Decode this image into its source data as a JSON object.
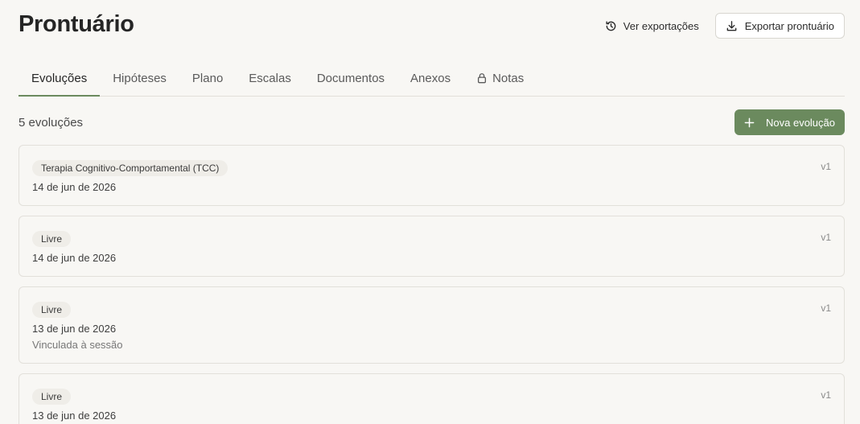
{
  "header": {
    "title": "Prontuário",
    "exports_label": "Ver exportações",
    "export_label": "Exportar prontuário"
  },
  "tabs": [
    {
      "label": "Evoluções",
      "active": true
    },
    {
      "label": "Hipóteses"
    },
    {
      "label": "Plano"
    },
    {
      "label": "Escalas"
    },
    {
      "label": "Documentos"
    },
    {
      "label": "Anexos"
    },
    {
      "label": "Notas",
      "icon": "lock-icon"
    }
  ],
  "toolbar": {
    "count": "5 evoluções",
    "new_label": "Nova evolução"
  },
  "evolutions": [
    {
      "badge": "Terapia Cognitivo-Comportamental (TCC)",
      "date": "14 de jun de 2026",
      "version": "v1"
    },
    {
      "badge": "Livre",
      "date": "14 de jun de 2026",
      "version": "v1"
    },
    {
      "badge": "Livre",
      "date": "13 de jun de 2026",
      "note": "Vinculada à sessão",
      "version": "v1"
    },
    {
      "badge": "Livre",
      "date": "13 de jun de 2026",
      "version": "v1"
    }
  ],
  "colors": {
    "accent": "#6b8a5e",
    "background": "#f8f7f4",
    "border": "#e2e0da"
  }
}
